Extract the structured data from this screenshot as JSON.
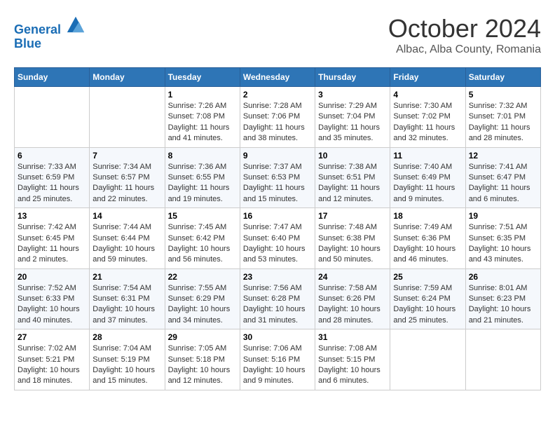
{
  "header": {
    "logo_line1": "General",
    "logo_line2": "Blue",
    "month": "October 2024",
    "location": "Albac, Alba County, Romania"
  },
  "days_of_week": [
    "Sunday",
    "Monday",
    "Tuesday",
    "Wednesday",
    "Thursday",
    "Friday",
    "Saturday"
  ],
  "weeks": [
    [
      {
        "day": "",
        "sunrise": "",
        "sunset": "",
        "daylight": ""
      },
      {
        "day": "",
        "sunrise": "",
        "sunset": "",
        "daylight": ""
      },
      {
        "day": "1",
        "sunrise": "Sunrise: 7:26 AM",
        "sunset": "Sunset: 7:08 PM",
        "daylight": "Daylight: 11 hours and 41 minutes."
      },
      {
        "day": "2",
        "sunrise": "Sunrise: 7:28 AM",
        "sunset": "Sunset: 7:06 PM",
        "daylight": "Daylight: 11 hours and 38 minutes."
      },
      {
        "day": "3",
        "sunrise": "Sunrise: 7:29 AM",
        "sunset": "Sunset: 7:04 PM",
        "daylight": "Daylight: 11 hours and 35 minutes."
      },
      {
        "day": "4",
        "sunrise": "Sunrise: 7:30 AM",
        "sunset": "Sunset: 7:02 PM",
        "daylight": "Daylight: 11 hours and 32 minutes."
      },
      {
        "day": "5",
        "sunrise": "Sunrise: 7:32 AM",
        "sunset": "Sunset: 7:01 PM",
        "daylight": "Daylight: 11 hours and 28 minutes."
      }
    ],
    [
      {
        "day": "6",
        "sunrise": "Sunrise: 7:33 AM",
        "sunset": "Sunset: 6:59 PM",
        "daylight": "Daylight: 11 hours and 25 minutes."
      },
      {
        "day": "7",
        "sunrise": "Sunrise: 7:34 AM",
        "sunset": "Sunset: 6:57 PM",
        "daylight": "Daylight: 11 hours and 22 minutes."
      },
      {
        "day": "8",
        "sunrise": "Sunrise: 7:36 AM",
        "sunset": "Sunset: 6:55 PM",
        "daylight": "Daylight: 11 hours and 19 minutes."
      },
      {
        "day": "9",
        "sunrise": "Sunrise: 7:37 AM",
        "sunset": "Sunset: 6:53 PM",
        "daylight": "Daylight: 11 hours and 15 minutes."
      },
      {
        "day": "10",
        "sunrise": "Sunrise: 7:38 AM",
        "sunset": "Sunset: 6:51 PM",
        "daylight": "Daylight: 11 hours and 12 minutes."
      },
      {
        "day": "11",
        "sunrise": "Sunrise: 7:40 AM",
        "sunset": "Sunset: 6:49 PM",
        "daylight": "Daylight: 11 hours and 9 minutes."
      },
      {
        "day": "12",
        "sunrise": "Sunrise: 7:41 AM",
        "sunset": "Sunset: 6:47 PM",
        "daylight": "Daylight: 11 hours and 6 minutes."
      }
    ],
    [
      {
        "day": "13",
        "sunrise": "Sunrise: 7:42 AM",
        "sunset": "Sunset: 6:45 PM",
        "daylight": "Daylight: 11 hours and 2 minutes."
      },
      {
        "day": "14",
        "sunrise": "Sunrise: 7:44 AM",
        "sunset": "Sunset: 6:44 PM",
        "daylight": "Daylight: 10 hours and 59 minutes."
      },
      {
        "day": "15",
        "sunrise": "Sunrise: 7:45 AM",
        "sunset": "Sunset: 6:42 PM",
        "daylight": "Daylight: 10 hours and 56 minutes."
      },
      {
        "day": "16",
        "sunrise": "Sunrise: 7:47 AM",
        "sunset": "Sunset: 6:40 PM",
        "daylight": "Daylight: 10 hours and 53 minutes."
      },
      {
        "day": "17",
        "sunrise": "Sunrise: 7:48 AM",
        "sunset": "Sunset: 6:38 PM",
        "daylight": "Daylight: 10 hours and 50 minutes."
      },
      {
        "day": "18",
        "sunrise": "Sunrise: 7:49 AM",
        "sunset": "Sunset: 6:36 PM",
        "daylight": "Daylight: 10 hours and 46 minutes."
      },
      {
        "day": "19",
        "sunrise": "Sunrise: 7:51 AM",
        "sunset": "Sunset: 6:35 PM",
        "daylight": "Daylight: 10 hours and 43 minutes."
      }
    ],
    [
      {
        "day": "20",
        "sunrise": "Sunrise: 7:52 AM",
        "sunset": "Sunset: 6:33 PM",
        "daylight": "Daylight: 10 hours and 40 minutes."
      },
      {
        "day": "21",
        "sunrise": "Sunrise: 7:54 AM",
        "sunset": "Sunset: 6:31 PM",
        "daylight": "Daylight: 10 hours and 37 minutes."
      },
      {
        "day": "22",
        "sunrise": "Sunrise: 7:55 AM",
        "sunset": "Sunset: 6:29 PM",
        "daylight": "Daylight: 10 hours and 34 minutes."
      },
      {
        "day": "23",
        "sunrise": "Sunrise: 7:56 AM",
        "sunset": "Sunset: 6:28 PM",
        "daylight": "Daylight: 10 hours and 31 minutes."
      },
      {
        "day": "24",
        "sunrise": "Sunrise: 7:58 AM",
        "sunset": "Sunset: 6:26 PM",
        "daylight": "Daylight: 10 hours and 28 minutes."
      },
      {
        "day": "25",
        "sunrise": "Sunrise: 7:59 AM",
        "sunset": "Sunset: 6:24 PM",
        "daylight": "Daylight: 10 hours and 25 minutes."
      },
      {
        "day": "26",
        "sunrise": "Sunrise: 8:01 AM",
        "sunset": "Sunset: 6:23 PM",
        "daylight": "Daylight: 10 hours and 21 minutes."
      }
    ],
    [
      {
        "day": "27",
        "sunrise": "Sunrise: 7:02 AM",
        "sunset": "Sunset: 5:21 PM",
        "daylight": "Daylight: 10 hours and 18 minutes."
      },
      {
        "day": "28",
        "sunrise": "Sunrise: 7:04 AM",
        "sunset": "Sunset: 5:19 PM",
        "daylight": "Daylight: 10 hours and 15 minutes."
      },
      {
        "day": "29",
        "sunrise": "Sunrise: 7:05 AM",
        "sunset": "Sunset: 5:18 PM",
        "daylight": "Daylight: 10 hours and 12 minutes."
      },
      {
        "day": "30",
        "sunrise": "Sunrise: 7:06 AM",
        "sunset": "Sunset: 5:16 PM",
        "daylight": "Daylight: 10 hours and 9 minutes."
      },
      {
        "day": "31",
        "sunrise": "Sunrise: 7:08 AM",
        "sunset": "Sunset: 5:15 PM",
        "daylight": "Daylight: 10 hours and 6 minutes."
      },
      {
        "day": "",
        "sunrise": "",
        "sunset": "",
        "daylight": ""
      },
      {
        "day": "",
        "sunrise": "",
        "sunset": "",
        "daylight": ""
      }
    ]
  ]
}
